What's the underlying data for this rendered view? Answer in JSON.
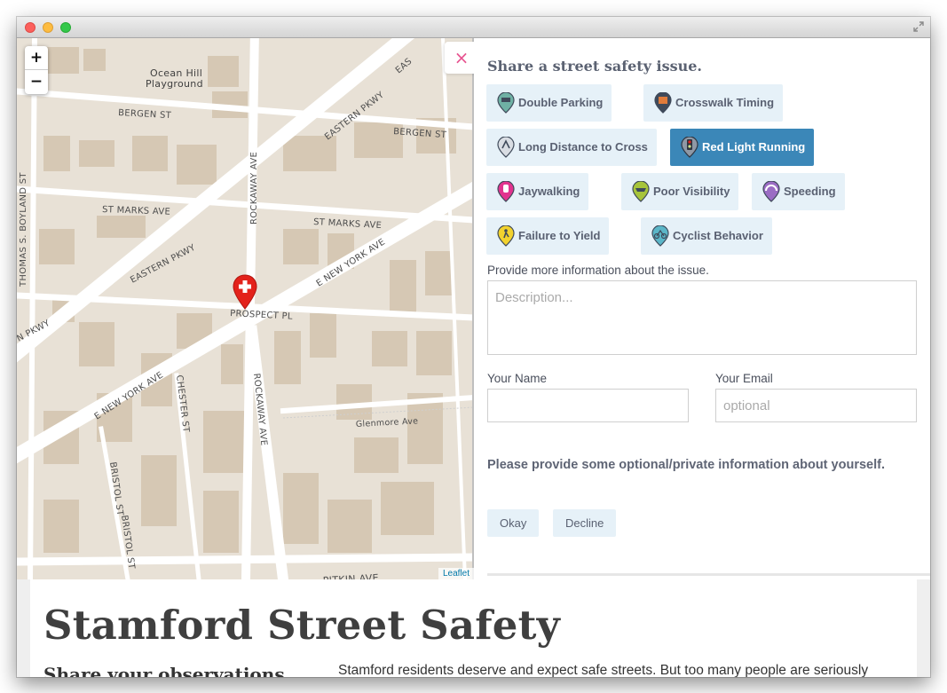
{
  "map": {
    "zoom_in": "+",
    "zoom_out": "−",
    "close": "×",
    "attribution": "Leaflet",
    "places": {
      "park": "Ocean Hill",
      "park2": "Playground",
      "bergen_w": "BERGEN ST",
      "bergen_e": "BERGEN ST",
      "eastern_ne": "EASTERN PKWY",
      "eastern_mid": "EASTERN PKWY",
      "eastern_sw": "N PKWY",
      "east_top": "EAS",
      "st_marks_w": "ST MARKS AVE",
      "st_marks_e": "ST MARKS AVE",
      "rockaway_n": "ROCKAWAY AVE",
      "rockaway_s": "ROCKAWAY AVE",
      "prospect": "PROSPECT PL",
      "new_york_ne": "E NEW YORK AVE",
      "new_york_sw": "E NEW YORK AVE",
      "thomas": "THOMAS S. BOYLAND ST",
      "chester": "CHESTER ST",
      "bristol1": "BRISTOL ST",
      "bristol2": "BRISTOL ST",
      "glenmore": "Glenmore Ave",
      "pitkin": "PITKIN AVE"
    }
  },
  "panel": {
    "heading": "Share a street safety issue.",
    "categories": [
      {
        "label": "Double Parking",
        "icon": "double-parking-icon",
        "color": "#6fb1a4",
        "active": false
      },
      {
        "label": "Crosswalk Timing",
        "icon": "crosswalk-timing-icon",
        "color": "#e07b3a",
        "active": false
      },
      {
        "label": "Long Distance to Cross",
        "icon": "long-distance-icon",
        "color": "#8f9aa8",
        "active": false
      },
      {
        "label": "Red Light Running",
        "icon": "red-light-icon",
        "color": "#5a5f6a",
        "active": true
      },
      {
        "label": "Jaywalking",
        "icon": "jaywalking-icon",
        "color": "#e2338f",
        "active": false
      },
      {
        "label": "Poor Visibility",
        "icon": "poor-visibility-icon",
        "color": "#a7c43a",
        "active": false
      },
      {
        "label": "Speeding",
        "icon": "speeding-icon",
        "color": "#9b6cc4",
        "active": false
      },
      {
        "label": "Failure to Yield",
        "icon": "failure-to-yield-icon",
        "color": "#f2d22e",
        "active": false
      },
      {
        "label": "Cyclist Behavior",
        "icon": "cyclist-icon",
        "color": "#5bb6c8",
        "active": false
      }
    ],
    "description_label": "Provide more information about the issue.",
    "description_placeholder": "Description...",
    "name_label": "Your Name",
    "name_value": "",
    "email_label": "Your Email",
    "email_placeholder": "optional",
    "question": "Please provide some optional/private information about yourself.",
    "okay": "Okay",
    "decline": "Decline"
  },
  "page": {
    "title": "Stamford Street Safety",
    "subheading": "Share your observations",
    "intro": "Stamford residents deserve and expect safe streets. But too many people are seriously"
  },
  "colors": {
    "accent": "#3b87b8",
    "chip_bg": "#e6f1f8",
    "marker": "#e3221b",
    "close_x": "#e75490"
  }
}
